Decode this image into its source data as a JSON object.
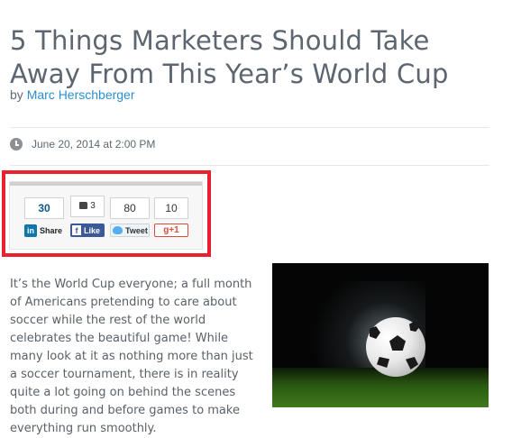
{
  "article": {
    "title": "5 Things Marketers Should Take Away From This Year’s World Cup",
    "by_label": "by",
    "author": "Marc Herschberger",
    "date": "June 20, 2014 at 2:00 PM",
    "body": "It’s the World Cup everyone; a full month of Americans pretending to care about soccer while the rest of the world celebrates the beautiful game! While many look at it as nothing more than just a soccer tournament, there is in reality quite a lot going on behind the scenes both during and before games to make everything run smoothly."
  },
  "share": {
    "linkedin": {
      "count": "30",
      "label": "Share",
      "logo": "in"
    },
    "facebook": {
      "count": "3",
      "label": "Like",
      "logo": "f"
    },
    "twitter": {
      "count": "80",
      "label": "Tweet"
    },
    "googleplus": {
      "count": "10",
      "label": "g+1"
    }
  },
  "colors": {
    "highlight": "#e8202f",
    "author_link": "#2a8fcf",
    "linkedin": "#0e76a8",
    "facebook": "#3b5998",
    "twitter": "#55acee",
    "googleplus": "#dd4b39"
  },
  "icons": {
    "date": "clock-icon",
    "like": "thumbs-up-icon",
    "twitter": "twitter-bird-icon"
  },
  "image": {
    "subject": "soccer-ball-on-grass"
  }
}
